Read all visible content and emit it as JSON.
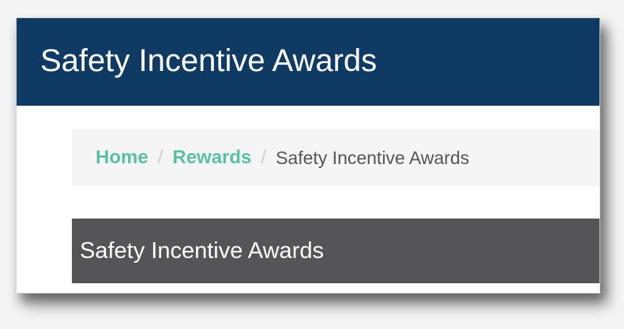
{
  "header": {
    "title": "Safety Incentive Awards"
  },
  "breadcrumb": {
    "items": [
      {
        "label": "Home"
      },
      {
        "label": "Rewards"
      }
    ],
    "separator": "/",
    "current": "Safety Incentive Awards"
  },
  "section": {
    "title": "Safety Incentive Awards"
  },
  "colors": {
    "header_bg": "#0e3a63",
    "link": "#5bbfa6",
    "section_bg": "#555558"
  }
}
